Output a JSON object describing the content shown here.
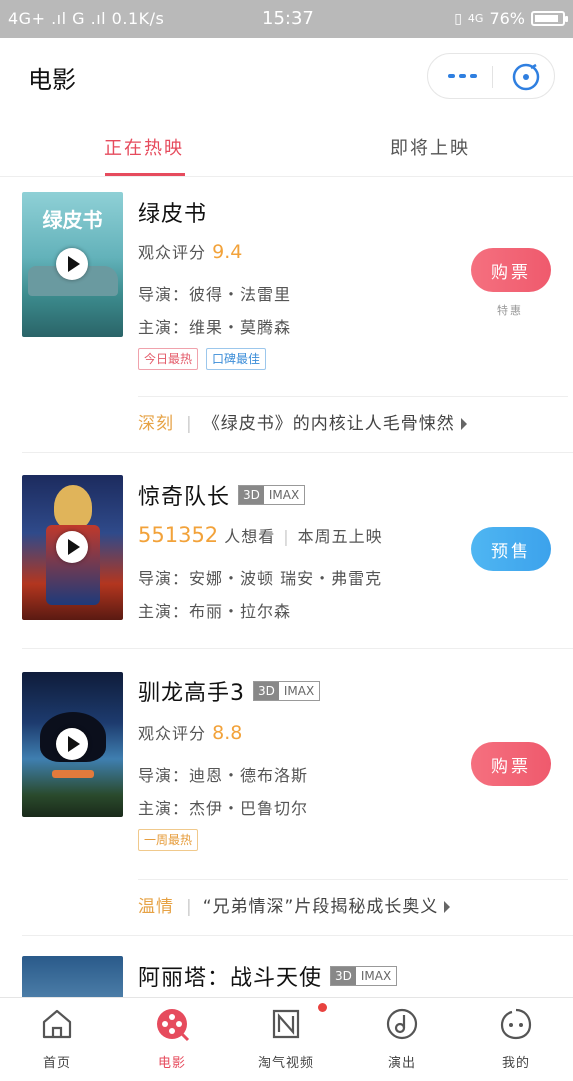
{
  "status_bar": {
    "network_left": "4G+ .ıl  G .ıl  0.1K/s",
    "time": "15:37",
    "network_right": "4G",
    "battery": "76%",
    "battery_level": 0.76
  },
  "header": {
    "title": "电影"
  },
  "tabs": [
    {
      "label": "正在热映",
      "active": true
    },
    {
      "label": "即将上映",
      "active": false
    }
  ],
  "movies": [
    {
      "title": "绿皮书",
      "poster_text": "绿皮书",
      "score_label": "观众评分",
      "score": "9.4",
      "director_label": "导演：",
      "director": "彼得・法雷里",
      "cast_label": "主演：",
      "cast": "维果・莫腾森",
      "tags": [
        "今日最热",
        "口碑最佳"
      ],
      "button": "购票",
      "button_note": "特惠",
      "rec_keyword": "深刻",
      "rec_text": "《绿皮书》的内核让人毛骨悚然"
    },
    {
      "title": "惊奇队长",
      "badge_3d": "3D",
      "badge_imax": "IMAX",
      "want_count": "551352",
      "want_label": "人想看",
      "release": "本周五上映",
      "director_label": "导演：",
      "director": "安娜・波顿 瑞安・弗雷克",
      "cast_label": "主演：",
      "cast": "布丽・拉尔森",
      "button": "预售"
    },
    {
      "title": "驯龙高手3",
      "badge_3d": "3D",
      "badge_imax": "IMAX",
      "score_label": "观众评分",
      "score": "8.8",
      "director_label": "导演：",
      "director": "迪恩・德布洛斯",
      "cast_label": "主演：",
      "cast": "杰伊・巴鲁切尔",
      "tags": [
        "一周最热"
      ],
      "button": "购票",
      "rec_keyword": "温情",
      "rec_text": "“兄弟情深”片段揭秘成长奥义"
    },
    {
      "title": "阿丽塔：战斗天使",
      "badge_3d": "3D",
      "badge_imax": "IMAX"
    }
  ],
  "bottom_nav": [
    {
      "label": "首页",
      "icon": "home-icon"
    },
    {
      "label": "电影",
      "icon": "film-reel-icon",
      "active": true
    },
    {
      "label": "淘气视频",
      "icon": "video-icon"
    },
    {
      "label": "演出",
      "icon": "music-note-icon"
    },
    {
      "label": "我的",
      "icon": "face-icon"
    }
  ],
  "colors": {
    "accent": "#e64b5d",
    "score": "#f2a23a",
    "presale": "#3ca2ec"
  }
}
